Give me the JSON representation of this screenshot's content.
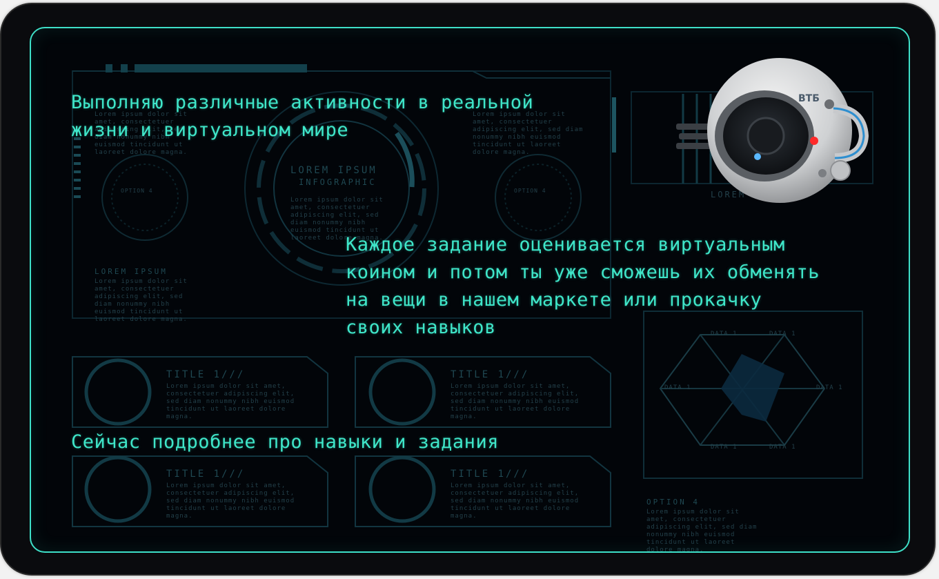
{
  "screen": {
    "intro_line1": "Выполняю различные активности в реальной",
    "intro_line2": "жизни и виртуальном мире",
    "coins_line1": "Каждое задание оценивается виртуальным",
    "coins_line2": "коином и потом ты уже сможешь их обменять",
    "coins_line3": "на вещи в нашем маркете или прокачку",
    "coins_line4": "своих навыков",
    "next_line": "Сейчас подробнее про навыки и задания"
  },
  "background_infographic": {
    "center_title": "LOREM IPSUM",
    "center_subtitle": "INFOGRAPHIC",
    "left_heading": "LOREM IPSUM",
    "card_title": "TITLE 1///",
    "lorem_short": "Lorem ipsum dolor sit amet, consectetuer adipiscing elit, sed diam nonummy nibh euismod tincidunt ut laoreet dolore magna.",
    "data_label": "DATA 1",
    "option_label": "OPTION 4",
    "option_small": "OPTION 4",
    "radar_labels": [
      "DATA 1",
      "DATA 1",
      "DATA 1",
      "DATA 1",
      "DATA 1",
      "DATA 1"
    ]
  },
  "mascot": {
    "brand": "ВТБ"
  },
  "colors": {
    "accent": "#3fe6c9",
    "frame": "#3ee0c8",
    "background": "#020509",
    "ghost": "#23404a"
  }
}
